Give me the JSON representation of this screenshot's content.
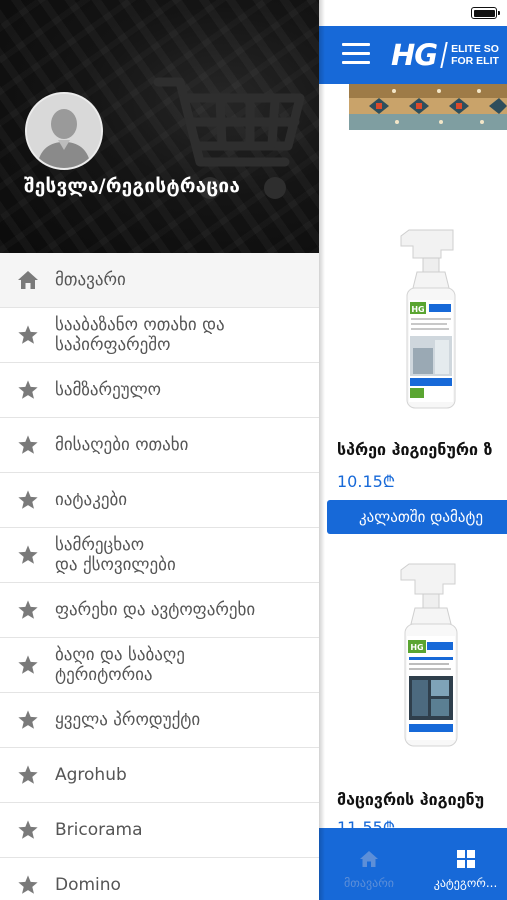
{
  "drawer": {
    "login_label": "შესვლა/რეგისტრაცია",
    "menu_items": [
      {
        "label": "მთავარი",
        "icon": "home-icon"
      },
      {
        "label": "სააბაზანო ოთახი და\nსაპირფარეშო",
        "icon": "star-icon"
      },
      {
        "label": "სამზარეულო",
        "icon": "star-icon"
      },
      {
        "label": "მისაღები ოთახი",
        "icon": "star-icon"
      },
      {
        "label": "იატაკები",
        "icon": "star-icon"
      },
      {
        "label": "სამრეცხაო\nდა ქსოვილები",
        "icon": "star-icon"
      },
      {
        "label": "ფარეხი და ავტოფარეხი",
        "icon": "star-icon"
      },
      {
        "label": "ბაღი და საბაღე\nტერიტორია",
        "icon": "star-icon"
      },
      {
        "label": "ყველა პროდუქტი",
        "icon": "star-icon"
      },
      {
        "label": "Agrohub",
        "icon": "star-icon"
      },
      {
        "label": "Bricorama",
        "icon": "star-icon"
      },
      {
        "label": "Domino",
        "icon": "star-icon"
      }
    ]
  },
  "header": {
    "logo_text": "HG",
    "tagline_line1": "ELITE SO",
    "tagline_line2": "FOR ELIT"
  },
  "products": [
    {
      "name": "სპრეი ჰიგიენური ზ",
      "price": "10.15₾",
      "button": "კალათში დამატე"
    },
    {
      "name": "მაცივრის ჰიგიენუ",
      "price": "11.55₾"
    }
  ],
  "bottom_nav": {
    "home_label": "მთავარი",
    "categories_label": "კატეგორ..."
  },
  "colors": {
    "accent": "#1769d8",
    "drawer_header": "#111111",
    "menu_icon": "#7a7a7a"
  }
}
